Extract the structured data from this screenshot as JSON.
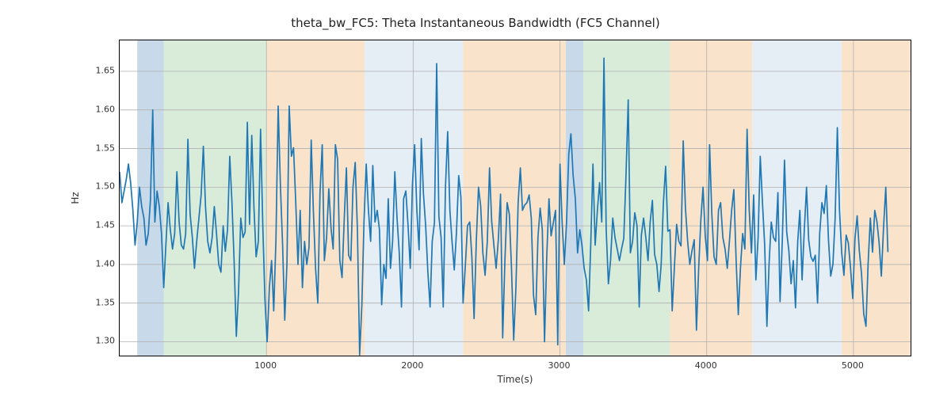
{
  "chart_data": {
    "type": "line",
    "title": "theta_bw_FC5: Theta Instantaneous Bandwidth (FC5 Channel)",
    "xlabel": "Time(s)",
    "ylabel": "Hz",
    "grid": true,
    "xlim": [
      0,
      5400
    ],
    "ylim": [
      1.28,
      1.69
    ],
    "xticks": [
      1000,
      2000,
      3000,
      4000,
      5000
    ],
    "yticks": [
      1.3,
      1.35,
      1.4,
      1.45,
      1.5,
      1.55,
      1.6,
      1.65
    ],
    "line_color": "#1f77b4",
    "background_bands": [
      {
        "start": 120,
        "end": 300,
        "color": "#b6cee2"
      },
      {
        "start": 300,
        "end": 1000,
        "color": "#cce6cc"
      },
      {
        "start": 1000,
        "end": 1670,
        "color": "#f7d9b8"
      },
      {
        "start": 1670,
        "end": 2340,
        "color": "#dce7f2"
      },
      {
        "start": 2340,
        "end": 3040,
        "color": "#f7d9b8"
      },
      {
        "start": 3040,
        "end": 3160,
        "color": "#b6cee2"
      },
      {
        "start": 3160,
        "end": 3750,
        "color": "#cce6cc"
      },
      {
        "start": 3750,
        "end": 4310,
        "color": "#f7d9b8"
      },
      {
        "start": 4310,
        "end": 4920,
        "color": "#dce7f2"
      },
      {
        "start": 4920,
        "end": 5400,
        "color": "#f7d9b8"
      }
    ],
    "x": [
      0,
      15,
      30,
      45,
      60,
      75,
      90,
      105,
      120,
      135,
      150,
      165,
      180,
      195,
      210,
      225,
      240,
      255,
      270,
      285,
      300,
      315,
      330,
      345,
      360,
      375,
      390,
      405,
      420,
      435,
      450,
      465,
      480,
      495,
      510,
      525,
      540,
      555,
      570,
      585,
      600,
      615,
      630,
      645,
      660,
      675,
      690,
      705,
      720,
      735,
      750,
      765,
      780,
      795,
      810,
      825,
      840,
      855,
      870,
      885,
      900,
      915,
      930,
      945,
      960,
      975,
      990,
      1005,
      1020,
      1035,
      1050,
      1065,
      1080,
      1095,
      1110,
      1125,
      1140,
      1155,
      1170,
      1185,
      1200,
      1215,
      1230,
      1245,
      1260,
      1275,
      1290,
      1305,
      1320,
      1335,
      1350,
      1365,
      1380,
      1395,
      1410,
      1425,
      1440,
      1455,
      1470,
      1485,
      1500,
      1515,
      1530,
      1545,
      1560,
      1575,
      1590,
      1605,
      1620,
      1635,
      1650,
      1665,
      1680,
      1695,
      1710,
      1725,
      1740,
      1755,
      1770,
      1785,
      1800,
      1815,
      1830,
      1845,
      1860,
      1875,
      1890,
      1905,
      1920,
      1935,
      1950,
      1965,
      1980,
      1995,
      2010,
      2025,
      2040,
      2055,
      2070,
      2085,
      2100,
      2115,
      2130,
      2145,
      2160,
      2175,
      2190,
      2205,
      2220,
      2235,
      2250,
      2265,
      2280,
      2295,
      2310,
      2325,
      2340,
      2355,
      2370,
      2385,
      2400,
      2415,
      2430,
      2445,
      2460,
      2475,
      2490,
      2505,
      2520,
      2535,
      2550,
      2565,
      2580,
      2595,
      2610,
      2625,
      2640,
      2655,
      2670,
      2685,
      2700,
      2715,
      2730,
      2745,
      2760,
      2775,
      2790,
      2805,
      2820,
      2835,
      2850,
      2865,
      2880,
      2895,
      2910,
      2925,
      2940,
      2955,
      2970,
      2985,
      3000,
      3015,
      3030,
      3045,
      3060,
      3075,
      3090,
      3105,
      3120,
      3135,
      3150,
      3165,
      3180,
      3195,
      3210,
      3225,
      3240,
      3255,
      3270,
      3285,
      3300,
      3315,
      3330,
      3345,
      3360,
      3375,
      3390,
      3405,
      3420,
      3435,
      3450,
      3465,
      3480,
      3495,
      3510,
      3525,
      3540,
      3555,
      3570,
      3585,
      3600,
      3615,
      3630,
      3645,
      3660,
      3675,
      3690,
      3705,
      3720,
      3735,
      3750,
      3765,
      3780,
      3795,
      3810,
      3825,
      3840,
      3855,
      3870,
      3885,
      3900,
      3915,
      3930,
      3945,
      3960,
      3975,
      3990,
      4005,
      4020,
      4035,
      4050,
      4065,
      4080,
      4095,
      4110,
      4125,
      4140,
      4155,
      4170,
      4185,
      4200,
      4215,
      4230,
      4245,
      4260,
      4275,
      4290,
      4305,
      4320,
      4335,
      4350,
      4365,
      4380,
      4395,
      4410,
      4425,
      4440,
      4455,
      4470,
      4485,
      4500,
      4515,
      4530,
      4545,
      4560,
      4575,
      4590,
      4605,
      4620,
      4635,
      4650,
      4665,
      4680,
      4695,
      4710,
      4725,
      4740,
      4755,
      4770,
      4785,
      4800,
      4815,
      4830,
      4845,
      4860,
      4875,
      4890,
      4905,
      4920,
      4935,
      4950,
      4965,
      4980,
      4995,
      5010,
      5025,
      5040,
      5055,
      5070,
      5085,
      5100,
      5115,
      5130,
      5145,
      5160,
      5175,
      5190,
      5205,
      5220,
      5235,
      5250,
      5265,
      5280,
      5295,
      5310,
      5325,
      5340,
      5355,
      5370,
      5385
    ],
    "y": [
      1.52,
      1.48,
      1.495,
      1.51,
      1.53,
      1.505,
      1.47,
      1.425,
      1.455,
      1.5,
      1.475,
      1.46,
      1.425,
      1.44,
      1.485,
      1.6,
      1.455,
      1.495,
      1.475,
      1.44,
      1.37,
      1.425,
      1.48,
      1.445,
      1.42,
      1.44,
      1.52,
      1.455,
      1.425,
      1.42,
      1.44,
      1.562,
      1.465,
      1.435,
      1.395,
      1.43,
      1.46,
      1.49,
      1.553,
      1.475,
      1.43,
      1.415,
      1.435,
      1.475,
      1.44,
      1.4,
      1.39,
      1.45,
      1.417,
      1.445,
      1.54,
      1.48,
      1.405,
      1.307,
      1.365,
      1.46,
      1.435,
      1.442,
      1.584,
      1.452,
      1.567,
      1.475,
      1.41,
      1.43,
      1.575,
      1.45,
      1.355,
      1.3,
      1.37,
      1.405,
      1.34,
      1.432,
      1.605,
      1.503,
      1.425,
      1.328,
      1.402,
      1.605,
      1.54,
      1.551,
      1.48,
      1.4,
      1.47,
      1.37,
      1.43,
      1.4,
      1.422,
      1.561,
      1.47,
      1.395,
      1.35,
      1.493,
      1.555,
      1.405,
      1.435,
      1.498,
      1.447,
      1.42,
      1.555,
      1.536,
      1.405,
      1.383,
      1.457,
      1.525,
      1.412,
      1.405,
      1.5,
      1.532,
      1.445,
      1.283,
      1.347,
      1.455,
      1.53,
      1.47,
      1.43,
      1.528,
      1.455,
      1.47,
      1.445,
      1.348,
      1.4,
      1.382,
      1.485,
      1.395,
      1.43,
      1.52,
      1.46,
      1.415,
      1.345,
      1.485,
      1.495,
      1.45,
      1.395,
      1.503,
      1.555,
      1.47,
      1.419,
      1.563,
      1.492,
      1.45,
      1.39,
      1.345,
      1.43,
      1.454,
      1.66,
      1.462,
      1.435,
      1.345,
      1.5,
      1.572,
      1.47,
      1.43,
      1.393,
      1.442,
      1.515,
      1.487,
      1.35,
      1.397,
      1.45,
      1.455,
      1.41,
      1.33,
      1.43,
      1.5,
      1.475,
      1.415,
      1.386,
      1.43,
      1.525,
      1.456,
      1.425,
      1.395,
      1.432,
      1.491,
      1.305,
      1.405,
      1.48,
      1.465,
      1.396,
      1.302,
      1.37,
      1.48,
      1.525,
      1.47,
      1.477,
      1.48,
      1.49,
      1.46,
      1.36,
      1.335,
      1.435,
      1.473,
      1.445,
      1.3,
      1.41,
      1.485,
      1.437,
      1.454,
      1.47,
      1.296,
      1.53,
      1.455,
      1.4,
      1.455,
      1.543,
      1.569,
      1.515,
      1.485,
      1.415,
      1.445,
      1.425,
      1.395,
      1.38,
      1.34,
      1.425,
      1.53,
      1.425,
      1.47,
      1.506,
      1.455,
      1.667,
      1.445,
      1.375,
      1.405,
      1.46,
      1.435,
      1.42,
      1.405,
      1.42,
      1.434,
      1.515,
      1.613,
      1.415,
      1.43,
      1.467,
      1.45,
      1.345,
      1.438,
      1.46,
      1.435,
      1.405,
      1.455,
      1.483,
      1.413,
      1.4,
      1.365,
      1.4,
      1.48,
      1.527,
      1.443,
      1.445,
      1.34,
      1.397,
      1.452,
      1.43,
      1.424,
      1.56,
      1.473,
      1.43,
      1.4,
      1.418,
      1.432,
      1.315,
      1.395,
      1.457,
      1.5,
      1.437,
      1.405,
      1.555,
      1.465,
      1.41,
      1.4,
      1.47,
      1.48,
      1.435,
      1.42,
      1.395,
      1.43,
      1.47,
      1.497,
      1.407,
      1.335,
      1.395,
      1.44,
      1.42,
      1.575,
      1.47,
      1.415,
      1.49,
      1.38,
      1.435,
      1.54,
      1.48,
      1.425,
      1.32,
      1.4,
      1.455,
      1.435,
      1.43,
      1.493,
      1.352,
      1.43,
      1.535,
      1.442,
      1.418,
      1.375,
      1.405,
      1.344,
      1.43,
      1.47,
      1.38,
      1.445,
      1.5,
      1.432,
      1.41,
      1.404,
      1.412,
      1.35,
      1.44,
      1.48,
      1.466,
      1.502,
      1.432,
      1.385,
      1.4,
      1.46,
      1.577,
      1.47,
      1.415,
      1.386,
      1.438,
      1.428,
      1.396,
      1.356,
      1.433,
      1.463,
      1.418,
      1.388,
      1.336,
      1.32,
      1.401,
      1.46,
      1.416,
      1.47,
      1.455,
      1.428,
      1.385,
      1.448,
      1.5,
      1.416
    ]
  }
}
